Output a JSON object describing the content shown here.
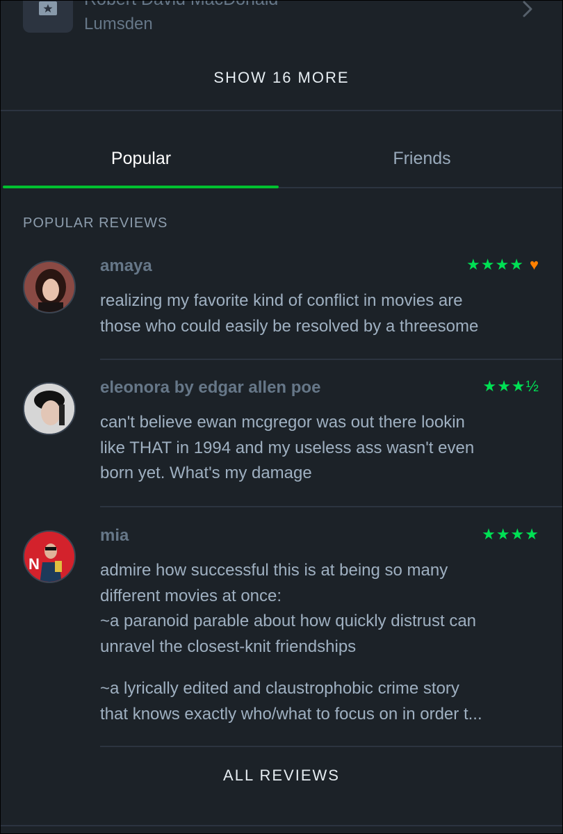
{
  "crew": {
    "name": "Robert David MacDonald",
    "role": "Lumsden"
  },
  "show_more_label": "SHOW 16 MORE",
  "tabs": [
    {
      "label": "Popular",
      "active": true
    },
    {
      "label": "Friends",
      "active": false
    }
  ],
  "section_heading": "POPULAR REVIEWS",
  "colors": {
    "accent_green": "#00e054",
    "heart_orange": "#ff8000",
    "tab_indicator": "#00c030"
  },
  "reviews": [
    {
      "author": "amaya",
      "rating": "★★★★",
      "liked": true,
      "lines": [
        "realizing my favorite kind of conflict in movies are",
        "those who could easily be resolved by a threesome"
      ]
    },
    {
      "author": "eleonora by edgar allen poe",
      "rating": "★★★½",
      "liked": false,
      "lines": [
        "can't believe ewan mcgregor was out there lookin",
        "like THAT in 1994 and my useless ass wasn't even",
        "born yet. What's my damage"
      ]
    },
    {
      "author": "mia",
      "rating": "★★★★",
      "liked": false,
      "lines": [
        "admire how successful this is at being so many",
        "different movies at once:",
        "~a paranoid parable about how quickly distrust can",
        "unravel the closest-knit friendships"
      ],
      "lines2": [
        "~a lyrically edited and claustrophobic crime story",
        "that knows exactly who/what to focus on in order t..."
      ]
    }
  ],
  "all_reviews_label": "ALL REVIEWS"
}
